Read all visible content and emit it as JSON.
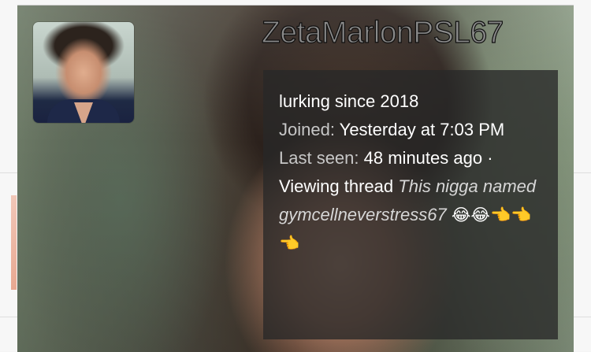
{
  "member": {
    "username": "ZetaMarlonPSL67",
    "custom_title": "lurking since 2018",
    "joined_label": "Joined:",
    "joined_value": "Yesterday at 7:03 PM",
    "last_seen_label": "Last seen:",
    "last_seen_value": "48 minutes ago",
    "separator": "·",
    "activity_prefix": "Viewing thread",
    "thread_title": "This nigga named gymcellneverstress67",
    "thread_emojis": "😂😂👈👈👈"
  },
  "colors": {
    "info_box_bg": "#282828",
    "username_fill": "#8a8a8a",
    "muted_text": "#c7c7c7"
  },
  "icons": {
    "avatar": "avatar-photo",
    "background": "cover-photo"
  }
}
